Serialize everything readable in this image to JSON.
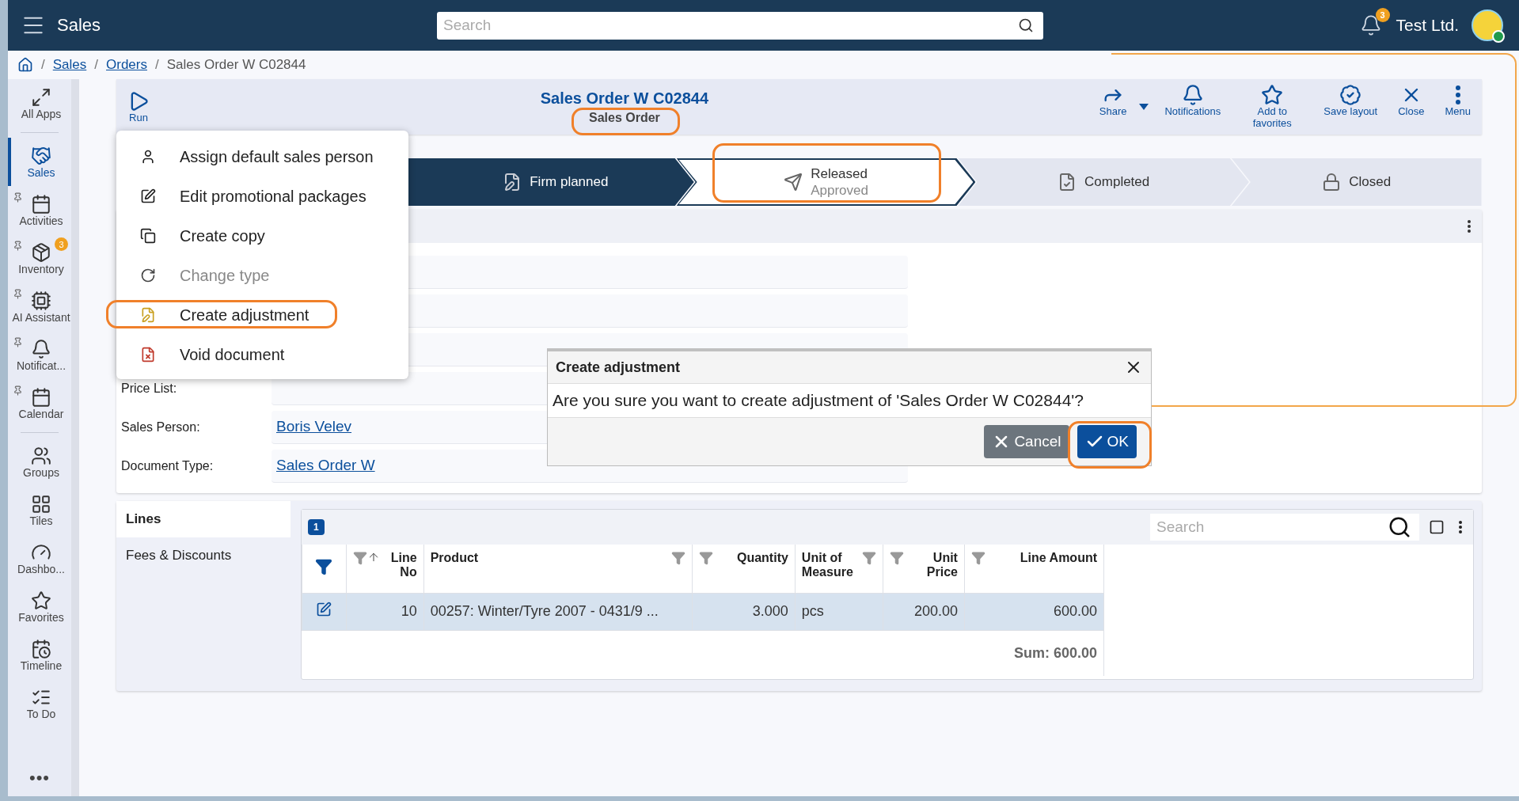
{
  "app_bar": {
    "title": "Sales",
    "search": {
      "placeholder": "Search"
    },
    "notification_badge": "3",
    "company": "Test Ltd."
  },
  "breadcrumb": [
    {
      "separator": "/",
      "label": "Sales",
      "kind": "link"
    },
    {
      "separator": "/",
      "label": "Orders",
      "kind": "link"
    },
    {
      "separator": "/",
      "label": "Sales Order W C02844",
      "kind": "current"
    }
  ],
  "sidebar": {
    "items": [
      {
        "label": "All Apps",
        "selected": false,
        "pinned": false
      },
      {
        "label": "Sales",
        "selected": true,
        "pinned": false
      },
      {
        "label": "Activities",
        "selected": false,
        "pinned": true
      },
      {
        "label": "Inventory",
        "selected": false,
        "pinned": true,
        "badge": "3"
      },
      {
        "label": "AI Assistant",
        "selected": false,
        "pinned": true
      },
      {
        "label": "Notificat...",
        "selected": false,
        "pinned": true
      },
      {
        "label": "Calendar",
        "selected": false,
        "pinned": true
      },
      {
        "label": "Groups",
        "selected": false,
        "pinned": false
      },
      {
        "label": "Tiles",
        "selected": false,
        "pinned": false
      },
      {
        "label": "Dashbo...",
        "selected": false,
        "pinned": false
      },
      {
        "label": "Favorites",
        "selected": false,
        "pinned": false
      },
      {
        "label": "Timeline",
        "selected": false,
        "pinned": false
      },
      {
        "label": "To Do",
        "selected": false,
        "pinned": false
      }
    ],
    "more": "•••"
  },
  "header": {
    "run": "Run",
    "title": "Sales Order W C02844",
    "subtitle": "Sales Order",
    "actions": [
      {
        "label": "Share",
        "dropdown": true
      },
      {
        "label": "Notifications",
        "dropdown": false
      },
      {
        "label": "Add to favorites",
        "dropdown": false
      },
      {
        "label": "Save layout",
        "dropdown": false
      },
      {
        "label": "Close",
        "dropdown": false
      },
      {
        "label": "Menu",
        "dropdown": false
      }
    ]
  },
  "steps": [
    {
      "label": "Firm planned",
      "completed": true,
      "current": false
    },
    {
      "label": "Released",
      "sublabel": "Approved",
      "completed": false,
      "current": true
    },
    {
      "label": "Completed",
      "completed": false,
      "current": false
    },
    {
      "label": "Closed",
      "completed": false,
      "current": false
    }
  ],
  "details": {
    "fields": [
      {
        "label": "Price List:",
        "kind": "empty"
      },
      {
        "label": "Sales Person:",
        "value": "Boris Velev",
        "kind": "link"
      },
      {
        "label": "Document Type:",
        "value": "Sales Order W",
        "kind": "link"
      }
    ]
  },
  "lines": {
    "tabs": [
      {
        "label": "Lines",
        "selected": true
      },
      {
        "label": "Fees & Discounts",
        "selected": false
      }
    ],
    "count_badge": "1",
    "search": {
      "placeholder": "Search"
    },
    "columns": [
      {
        "label": "Line No",
        "kind": "number",
        "sorted": true
      },
      {
        "label": "Product",
        "kind": "text",
        "sorted": false
      },
      {
        "label": "Quantity",
        "kind": "number",
        "sorted": false
      },
      {
        "label": "Unit of Measure",
        "kind": "text",
        "sorted": false
      },
      {
        "label": "Unit Price",
        "kind": "number",
        "sorted": false
      },
      {
        "label": "Line Amount",
        "kind": "number",
        "sorted": false
      }
    ],
    "rows": [
      {
        "selected": true,
        "cells": [
          "10",
          "00257: Winter/Tyre 2007 - 0431/9 ...",
          "3.000",
          "pcs",
          "200.00",
          "600.00"
        ]
      }
    ],
    "sum": "Sum: 600.00"
  },
  "context_menu": {
    "items": [
      {
        "label": "Assign default sales person",
        "disabled": false,
        "highlighted": false
      },
      {
        "label": "Edit promotional packages",
        "disabled": false,
        "highlighted": false
      },
      {
        "label": "Create copy",
        "disabled": false,
        "highlighted": false
      },
      {
        "label": "Change type",
        "disabled": true,
        "highlighted": false
      },
      {
        "label": "Create adjustment",
        "disabled": false,
        "highlighted": true
      },
      {
        "label": "Void document",
        "disabled": false,
        "highlighted": false
      }
    ]
  },
  "dialog": {
    "title": "Create adjustment",
    "message": "Are you sure you want to create adjustment of 'Sales Order W C02844'?",
    "buttons": [
      {
        "label": "Cancel",
        "kind": "secondary"
      },
      {
        "label": "OK",
        "kind": "primary"
      }
    ]
  }
}
